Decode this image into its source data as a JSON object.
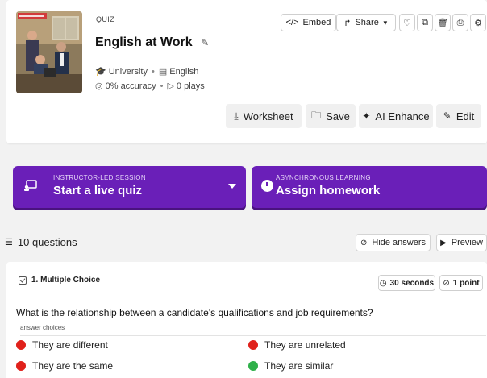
{
  "quiz": {
    "label": "QUIZ",
    "title": "English at Work",
    "level": "University",
    "subject": "English",
    "accuracy": "0% accuracy",
    "plays": "0 plays"
  },
  "toolbar": {
    "embed": "Embed",
    "share": "Share"
  },
  "actions": {
    "worksheet": "Worksheet",
    "save": "Save",
    "ai_enhance": "AI Enhance",
    "edit": "Edit"
  },
  "live_session": {
    "small": "INSTRUCTOR-LED SESSION",
    "big": "Start a live quiz"
  },
  "homework": {
    "small": "ASYNCHRONOUS LEARNING",
    "big": "Assign homework"
  },
  "questions": {
    "count_label": "10 questions",
    "hide_answers": "Hide answers",
    "preview": "Preview"
  },
  "question1": {
    "type_label": "1. Multiple Choice",
    "time": "30 seconds",
    "points": "1 point",
    "text": "What is the relationship between a candidate's qualifications and job requirements?",
    "answer_choices_label": "answer choices",
    "choices": [
      {
        "text": "They are different",
        "color": "#e0211b"
      },
      {
        "text": "They are unrelated",
        "color": "#e0211b"
      },
      {
        "text": "They are the same",
        "color": "#e0211b"
      },
      {
        "text": "They are similar",
        "color": "#2fb04a"
      }
    ]
  },
  "colors": {
    "purple": "#6a1fb8",
    "wrong": "#e0211b",
    "correct": "#2fb04a"
  }
}
